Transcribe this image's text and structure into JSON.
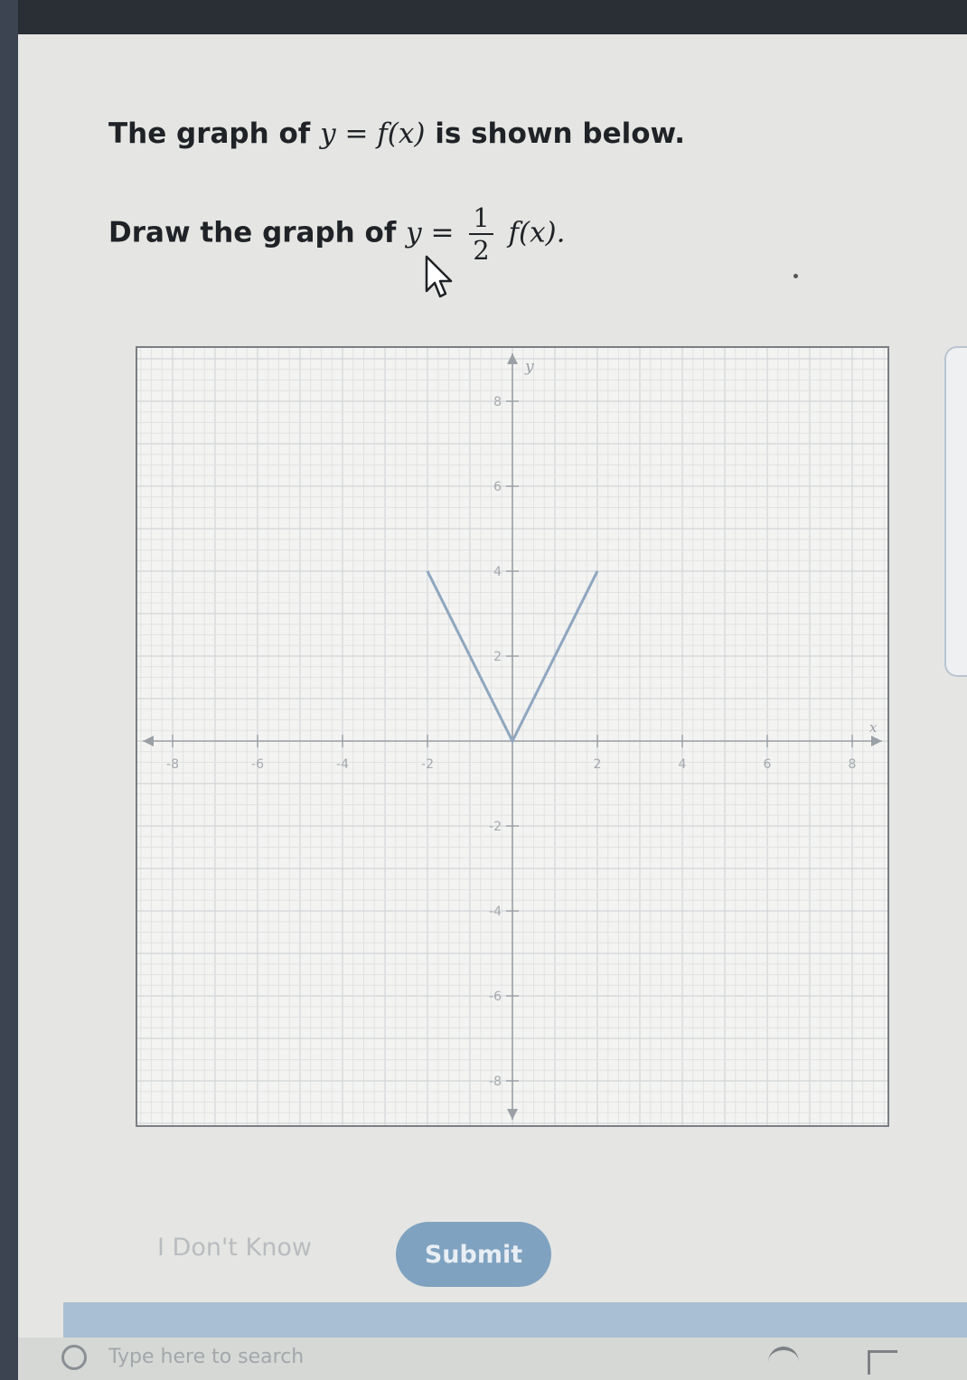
{
  "problem": {
    "line1_prefix": "The graph of",
    "line1_math": "y = f(x)",
    "line1_suffix": "is shown below.",
    "line2_prefix": "Draw the graph of",
    "line2_math_left": "y =",
    "fraction_numerator": "1",
    "fraction_denominator": "2",
    "line2_math_right": "f(x)."
  },
  "graph": {
    "x_axis_label": "x",
    "y_axis_label": "y",
    "xlim": [
      -9,
      9
    ],
    "ylim": [
      -9,
      9
    ],
    "x_tick_labels": [
      "-8",
      "-6",
      "-4",
      "-2",
      "2",
      "4",
      "6",
      "8"
    ],
    "y_tick_labels": [
      "8",
      "6",
      "4",
      "2",
      "-2",
      "-4",
      "-6",
      "-8"
    ],
    "grid": true,
    "line_color": "#8fa6bf"
  },
  "chart_data": {
    "type": "line",
    "title": "",
    "xlabel": "x",
    "ylabel": "y",
    "xlim": [
      -9,
      9
    ],
    "ylim": [
      -9,
      9
    ],
    "series": [
      {
        "x": [
          -2,
          0,
          2
        ],
        "y": [
          4,
          0,
          4
        ]
      }
    ]
  },
  "actions": {
    "dont_know_label": "I Don't Know",
    "submit_label": "Submit"
  },
  "taskbar": {
    "search_placeholder": "Type here to search"
  },
  "icons": {
    "cursor": "pointer-cursor-icon",
    "search": "search-icon"
  },
  "colors": {
    "submit_bg": "#7fa2c0",
    "footer_bar": "#a9bfd3"
  }
}
